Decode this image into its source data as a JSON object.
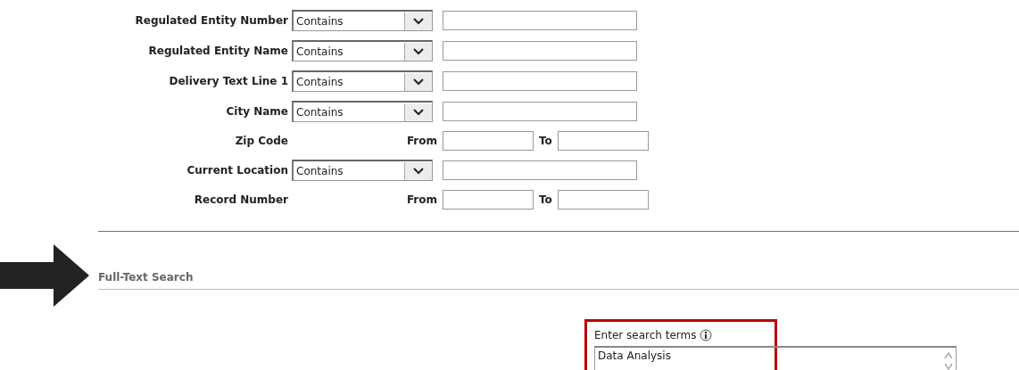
{
  "criteria": [
    {
      "kind": "select",
      "label": "Regulated Entity Number",
      "operator": "Contains"
    },
    {
      "kind": "select",
      "label": "Regulated Entity Name",
      "operator": "Contains"
    },
    {
      "kind": "select",
      "label": "Delivery Text Line 1",
      "operator": "Contains"
    },
    {
      "kind": "select",
      "label": "City Name",
      "operator": "Contains"
    },
    {
      "kind": "range",
      "label": "Zip Code",
      "from_label": "From",
      "to_label": "To"
    },
    {
      "kind": "select",
      "label": "Current Location",
      "operator": "Contains"
    },
    {
      "kind": "range",
      "label": "Record Number",
      "from_label": "From",
      "to_label": "To"
    }
  ],
  "full_text_search": {
    "heading": "Full-Text Search",
    "field_label": "Enter search terms",
    "value": "Data Analysis"
  }
}
